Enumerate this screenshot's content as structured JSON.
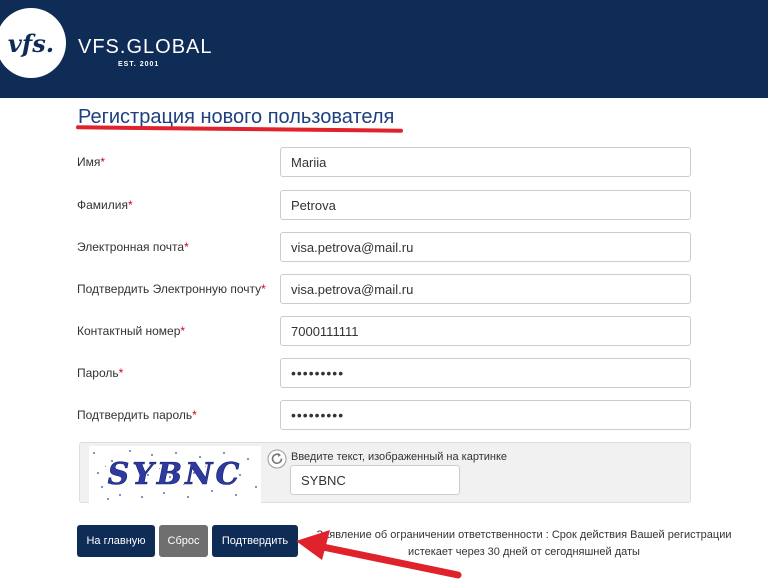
{
  "brand": {
    "logo_text": "vfs.",
    "name": "VFS.GLOBAL",
    "est": "EST. 2001",
    "color": "#0f2c57"
  },
  "form": {
    "title": "Регистрация нового пользователя",
    "required_mark": "*",
    "fields": [
      {
        "label": "Имя",
        "value": "Mariia"
      },
      {
        "label": "Фамилия",
        "value": "Petrova"
      },
      {
        "label": "Электронная почта",
        "value": "visa.petrova@mail.ru"
      },
      {
        "label": "Подтвердить Электронную почту",
        "value": "visa.petrova@mail.ru"
      },
      {
        "label": "Контактный номер",
        "value": "7000111111"
      },
      {
        "label": "Пароль",
        "value": "•••••••••"
      },
      {
        "label": "Подтвердить пароль",
        "value": "•••••••••"
      }
    ]
  },
  "captcha": {
    "image_text": "SYBNC",
    "label": "Введите текст, изображенный на картинке",
    "value": "SYBNC"
  },
  "buttons": {
    "home": "На главную",
    "reset": "Сброс",
    "submit": "Подтвердить"
  },
  "disclaimer": {
    "line1": "Заявление об ограничении ответственности : Срок действия Вашей регистрации",
    "line2": "истекает через 30 дней от сегодняшней даты"
  },
  "colors": {
    "accent_red": "#e0222c",
    "title_blue": "#1e3f80",
    "reset_gray": "#6f6f6f"
  }
}
